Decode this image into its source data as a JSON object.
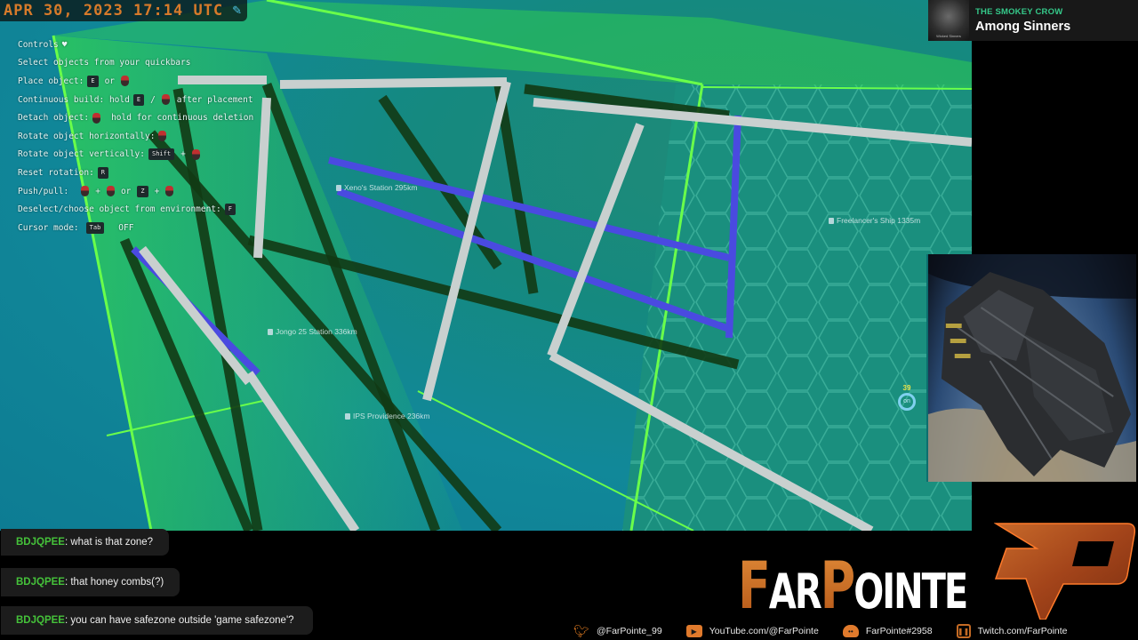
{
  "overlay": {
    "date": "APR 30, 2023 17:14 UTC"
  },
  "now_playing": {
    "artist": "THE SMOKEY CROW",
    "title": "Among Sinners",
    "art_caption": "Wicked Sinners"
  },
  "controls": {
    "heading": "Controls",
    "rows": [
      {
        "label": "Select objects from your quickbars"
      },
      {
        "label": "Place object:",
        "key1": "E",
        "sep": "or"
      },
      {
        "label": "Continuous build: hold",
        "key1": "E",
        "sep": "/",
        "suffix": "after placement"
      },
      {
        "label": "Detach object:",
        "suffix": "hold for continuous deletion"
      },
      {
        "label": "Rotate object horizontally:"
      },
      {
        "label": "Rotate object vertically:",
        "key1": "Shift",
        "sep": "+"
      },
      {
        "label": "Reset rotation:",
        "key1": "R"
      },
      {
        "label": "Push/pull:",
        "sep": "+",
        "sep2": "or",
        "key1": "Z",
        "sep3": "+"
      },
      {
        "label": "Deselect/choose object from environment:",
        "key1": "F"
      },
      {
        "label": "Cursor mode:",
        "key1": "Tab",
        "suffix": "OFF"
      }
    ]
  },
  "gps_markers": [
    {
      "name": "Xeno's Station",
      "distance": "295km"
    },
    {
      "name": "Freelancer's Ship",
      "distance": "1335m"
    },
    {
      "name": "Jongo 25 Station",
      "distance": "336km"
    },
    {
      "name": "IPS Providence",
      "distance": "236km"
    }
  ],
  "cursor_indicator": {
    "count": "39",
    "label": "on"
  },
  "chat": [
    {
      "user": "BDJQPEE",
      "message": ": what is that zone?"
    },
    {
      "user": "BDJQPEE",
      "message": ": that honey combs(?)"
    },
    {
      "user": "BDJQPEE",
      "message": ": you can have safezone outside 'game safezone'?"
    }
  ],
  "brand": {
    "letters": [
      {
        "ch": "F",
        "big": true
      },
      {
        "ch": "AR",
        "big": false
      },
      {
        "ch": "P",
        "big": true
      },
      {
        "ch": "OINTE",
        "big": false
      }
    ]
  },
  "socials": [
    {
      "icon": "twitter-icon",
      "label": "@FarPointe_99"
    },
    {
      "icon": "youtube-icon",
      "label": "YouTube.com/@FarPointe"
    },
    {
      "icon": "discord-icon",
      "label": "FarPointe#2958"
    },
    {
      "icon": "twitch-icon",
      "label": "Twitch.com/FarPointe"
    }
  ],
  "colors": {
    "accent_orange": "#d4742a",
    "chat_user": "#45c23a",
    "now_playing_artist": "#35c98a",
    "safezone_green": "#4cff3a"
  }
}
